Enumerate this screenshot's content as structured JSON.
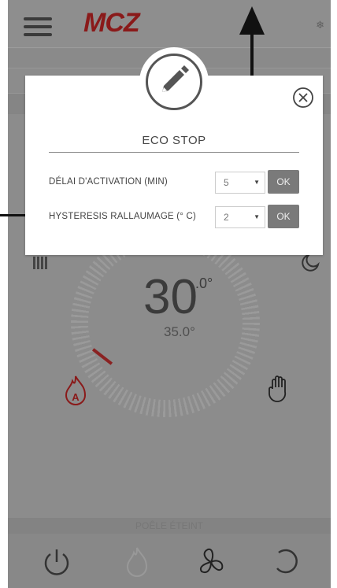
{
  "app": {
    "brand": "MCZ",
    "status_text": "POÊLE ÉTEINT"
  },
  "thermostat": {
    "current_temp": "30",
    "current_decimal": ".0°",
    "set_temp": "35.0°"
  },
  "modal": {
    "title": "ECO STOP",
    "rows": [
      {
        "label": "DÉLAI D'ACTIVATION (MIN)",
        "value": "5",
        "ok_label": "OK"
      },
      {
        "label": "HYSTERESIS RALLAUMAGE (° C)",
        "value": "2",
        "ok_label": "OK"
      }
    ]
  },
  "icons": {
    "menu": "hamburger-icon",
    "settings": "snowflake-icon",
    "edit": "pencil-icon",
    "close": "close-circle-icon",
    "power_bars": "bars-icon",
    "night": "moon-icon",
    "auto": "flame-auto-icon",
    "manual": "hand-icon",
    "power": "power-icon",
    "flame": "flame-icon",
    "fan": "fan-icon",
    "refresh": "refresh-icon"
  },
  "colors": {
    "brand": "#8a1a1a",
    "auto_flame": "#8a1a1a",
    "overlay_bg": "#8c8c8c",
    "ok_button": "#7a7a7a"
  }
}
